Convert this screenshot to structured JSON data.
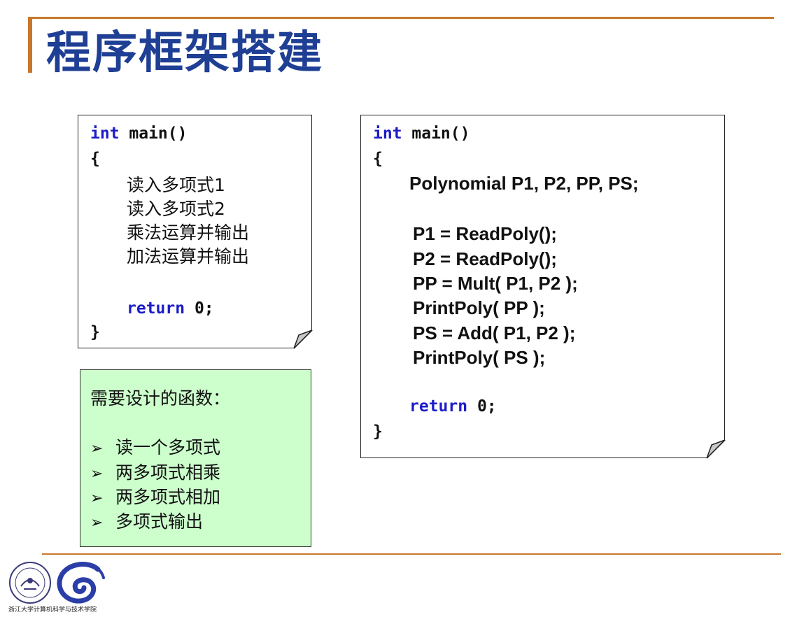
{
  "slide": {
    "title": "程序框架搭建"
  },
  "left_code": {
    "line1_kw": "int",
    "line1_rest": " main()",
    "open_brace": "{",
    "steps": [
      "读入多项式1",
      "读入多项式2",
      "乘法运算并输出",
      "加法运算并输出"
    ],
    "return_kw": "return",
    "return_rest": " 0;",
    "close_brace": "}"
  },
  "right_code": {
    "line1_kw": "int",
    "line1_rest": " main()",
    "open_brace": "{",
    "decl": "Polynomial P1, P2, PP, PS;",
    "stmts": [
      "P1 = ReadPoly();",
      "P2 = ReadPoly();",
      "PP = Mult( P1, P2 );",
      "PrintPoly( PP );",
      "PS = Add( P1, P2 );",
      "PrintPoly( PS );"
    ],
    "return_kw": "return",
    "return_rest": " 0;",
    "close_brace": "}"
  },
  "functions_box": {
    "heading": "需要设计的函数：",
    "bullet_glyph": "➢",
    "items": [
      "读一个多项式",
      "两多项式相乘",
      "两多项式相加",
      "多项式输出"
    ]
  },
  "footer": {
    "logo_caption": "浙江大学计算机科学与技术学院"
  },
  "colors": {
    "accent": "#c8782a",
    "title": "#1f3f95",
    "keyword": "#1c1cc8",
    "box_green": "#ccffcc"
  }
}
